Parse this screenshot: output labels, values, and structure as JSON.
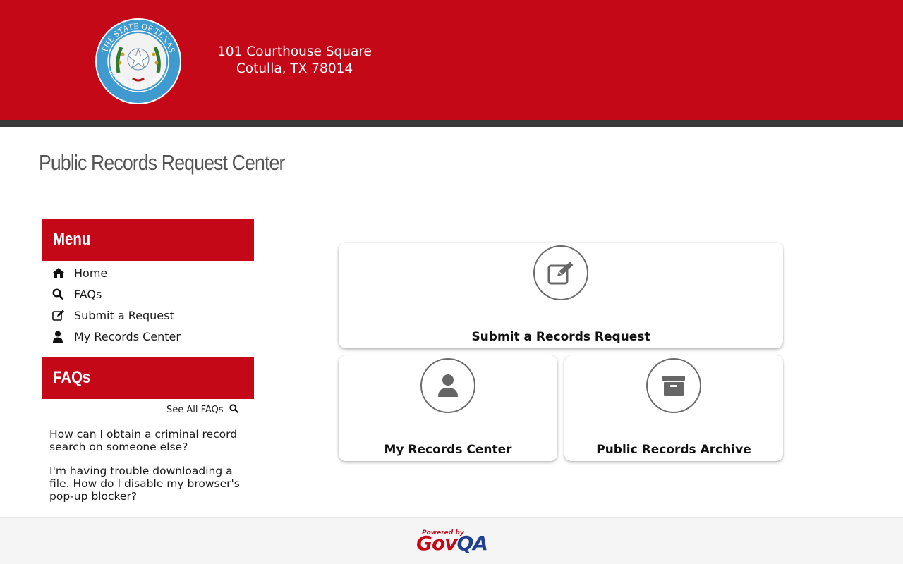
{
  "header": {
    "address_line1": "101 Courthouse Square",
    "address_line2": "Cotulla, TX 78014",
    "seal_text": "THE STATE OF TEXAS · LA SALLE COUNTY",
    "brand_color": "#c40818"
  },
  "page_title": "Public Records Request Center",
  "menu": {
    "heading": "Menu",
    "items": [
      {
        "label": "Home",
        "icon": "home-icon"
      },
      {
        "label": "FAQs",
        "icon": "search-icon"
      },
      {
        "label": "Submit a Request",
        "icon": "edit-icon"
      },
      {
        "label": "My Records Center",
        "icon": "user-icon"
      }
    ]
  },
  "faqs": {
    "heading": "FAQs",
    "see_all": "See All FAQs",
    "items": [
      "How can I obtain a criminal record search on someone else?",
      "I'm having trouble downloading a file. How do I disable my browser's pop-up blocker?"
    ]
  },
  "cards": {
    "submit": {
      "label": "Submit a Records Request",
      "icon": "edit-icon"
    },
    "my_records": {
      "label": "My Records Center",
      "icon": "user-icon"
    },
    "archive": {
      "label": "Public Records Archive",
      "icon": "archive-icon"
    }
  },
  "footer": {
    "powered_by": "Powered by",
    "brand_gov": "Gov",
    "brand_qa": "QA"
  }
}
